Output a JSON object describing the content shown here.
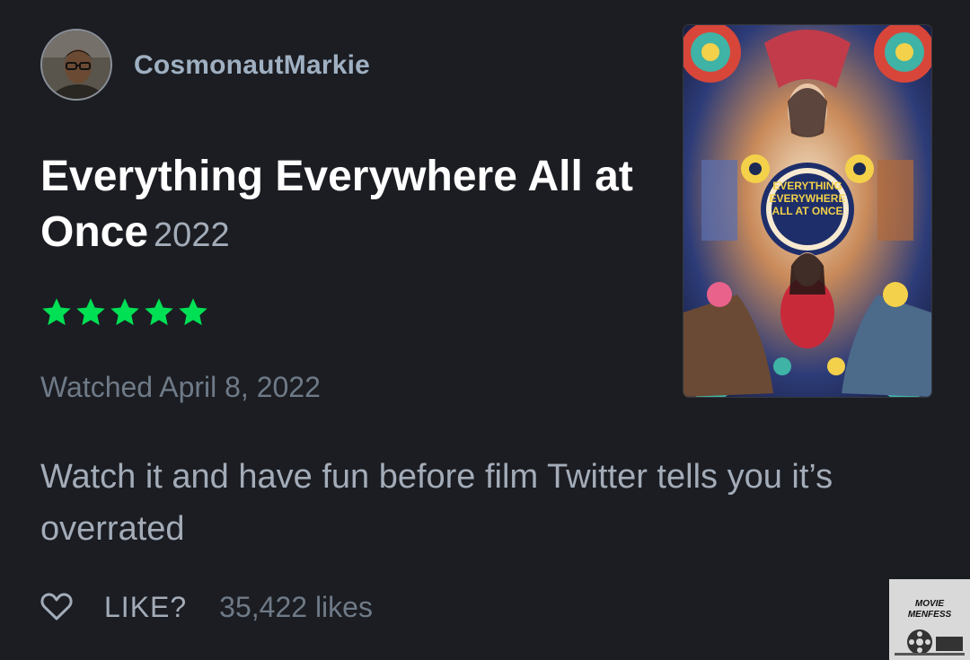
{
  "review": {
    "username": "CosmonautMarkie",
    "film_title": "Everything Everywhere All at Once",
    "film_year": "2022",
    "rating_stars": 5,
    "watched_text": "Watched April 8, 2022",
    "review_text": "Watch it and have fun before film Twitter tells you it’s overrated",
    "like_label": "LIKE?",
    "like_count": "35,422 likes"
  },
  "poster": {
    "title_lines": [
      "EVERYTHING",
      "EVERYWHERE",
      "ALL AT ONCE"
    ]
  },
  "watermark": {
    "line1": "MOVIE",
    "line2": "MENFESS"
  },
  "colors": {
    "background": "#1b1d22",
    "star": "#00e054",
    "username": "#9fb0c2",
    "title": "#ffffff",
    "muted": "#6f7a87",
    "body_text": "#a3acb8"
  },
  "icons": {
    "like": "heart-outline-icon",
    "rating": "star-icon"
  }
}
